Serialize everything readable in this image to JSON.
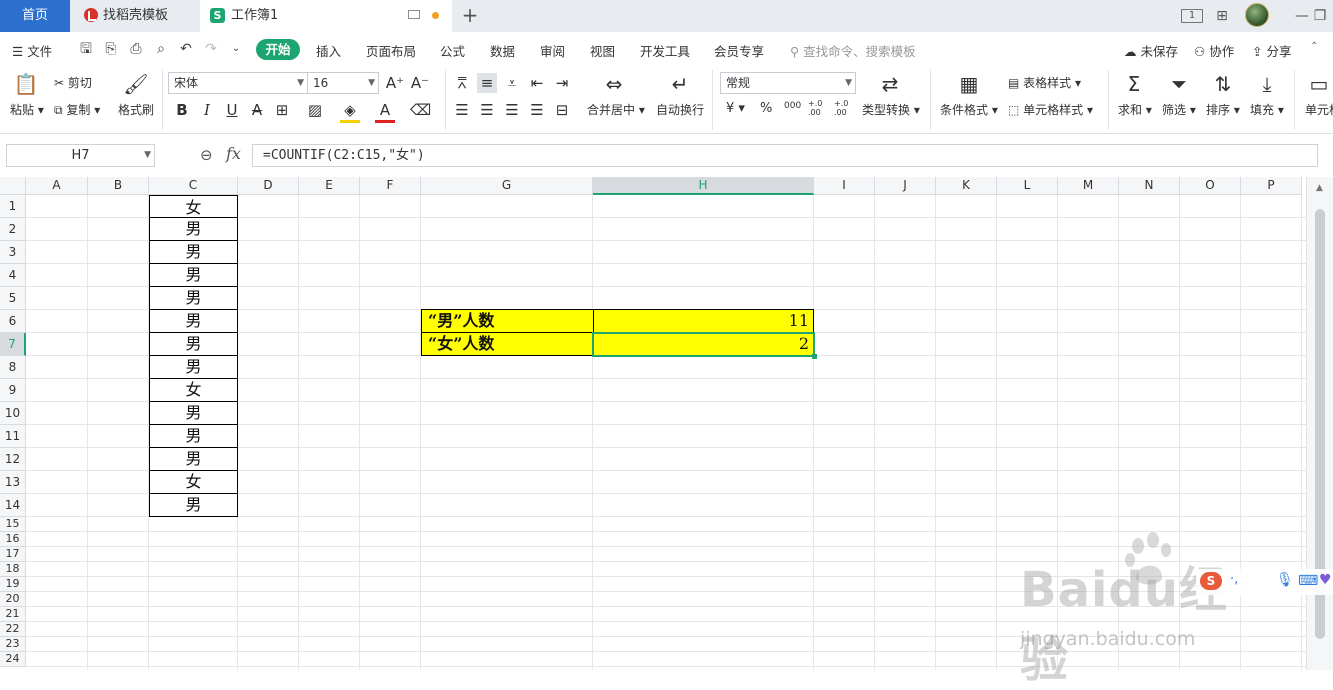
{
  "titlebar": {
    "tabs": [
      {
        "label": "首页"
      },
      {
        "label": "找稻壳模板"
      },
      {
        "label": "工作簿1",
        "logo_letter": "S"
      }
    ],
    "new_tab": "+",
    "window_controls": [
      "1",
      "⊞",
      "—",
      "❐"
    ]
  },
  "menu": {
    "file": "文件",
    "items": [
      "开始",
      "插入",
      "页面布局",
      "公式",
      "数据",
      "审阅",
      "视图",
      "开发工具",
      "会员专享"
    ],
    "search_placeholder": "查找命令、搜索模板",
    "right": [
      "未保存",
      "协作",
      "分享"
    ]
  },
  "ribbon": {
    "paste": "粘贴",
    "cut": "剪切",
    "copy": "复制",
    "format_painter": "格式刷",
    "font_name": "宋体",
    "font_size": "16",
    "merge_center": "合并居中",
    "wrap_text": "自动换行",
    "number_format": "常规",
    "type_convert": "类型转换",
    "conditional_format": "条件格式",
    "table_style": "表格样式",
    "cell_style": "单元格样式",
    "sum": "求和",
    "filter": "筛选",
    "sort": "排序",
    "fill": "填充",
    "cell": "单元格",
    "icons": {
      "currency": "¥",
      "percent": "%",
      "thousands": "000",
      "inc_decimal": "+.0 .00",
      "dec_decimal": "+.0 .00"
    }
  },
  "formula_bar": {
    "name_box": "H7",
    "fx": "fx",
    "formula": "=COUNTIF(C2:C15,\"女\")"
  },
  "grid": {
    "columns": [
      "A",
      "B",
      "C",
      "D",
      "E",
      "F",
      "G",
      "H",
      "I",
      "J",
      "K",
      "L",
      "M",
      "N",
      "O",
      "P"
    ],
    "rows": [
      "1",
      "2",
      "3",
      "4",
      "5",
      "6",
      "7",
      "8",
      "9",
      "10",
      "11",
      "12",
      "13",
      "14",
      "15",
      "16",
      "17",
      "18",
      "19",
      "20",
      "21",
      "22",
      "23",
      "24"
    ],
    "selected_column": "H",
    "selected_row": "7",
    "column_c": [
      "女",
      "男",
      "男",
      "男",
      "男",
      "男",
      "男",
      "男",
      "女",
      "男",
      "男",
      "男",
      "女",
      "男"
    ],
    "summary": [
      {
        "label": "“男”人数",
        "value": "11"
      },
      {
        "label": "“女”人数",
        "value": "2"
      }
    ],
    "highlight_color": "#ffff00",
    "accent_color": "#1da571"
  },
  "watermark": {
    "brand": "Baidu经验",
    "url": "jingyan.baidu.com"
  }
}
